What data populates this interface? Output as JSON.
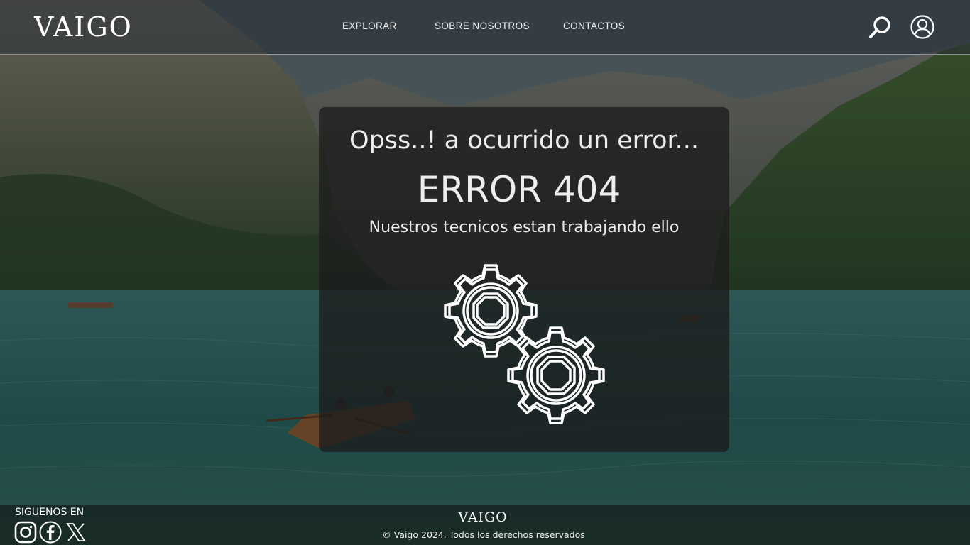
{
  "header": {
    "logo": "VAIGO",
    "nav": {
      "explorar": "EXPLORAR",
      "sobre": "SOBRE NOSOTROS",
      "contactos": "CONTACTOS"
    },
    "icons": {
      "search": "search-icon",
      "user": "user-circle-icon"
    }
  },
  "error_card": {
    "title": "Opss..! a ocurrido un error...",
    "code": "ERROR 404",
    "message": "Nuestros tecnicos estan trabajando ello",
    "illustration": "gears-icon"
  },
  "footer": {
    "follow_label": "SIGUENOS EN",
    "social": [
      "instagram-icon",
      "facebook-icon",
      "x-icon"
    ],
    "logo": "VAIGO",
    "copyright": "© Vaigo 2024. Todos los derechos reservados"
  },
  "colors": {
    "card_bg": "#1c1c1c",
    "text": "#ededed",
    "water": "#2f6f6a"
  }
}
